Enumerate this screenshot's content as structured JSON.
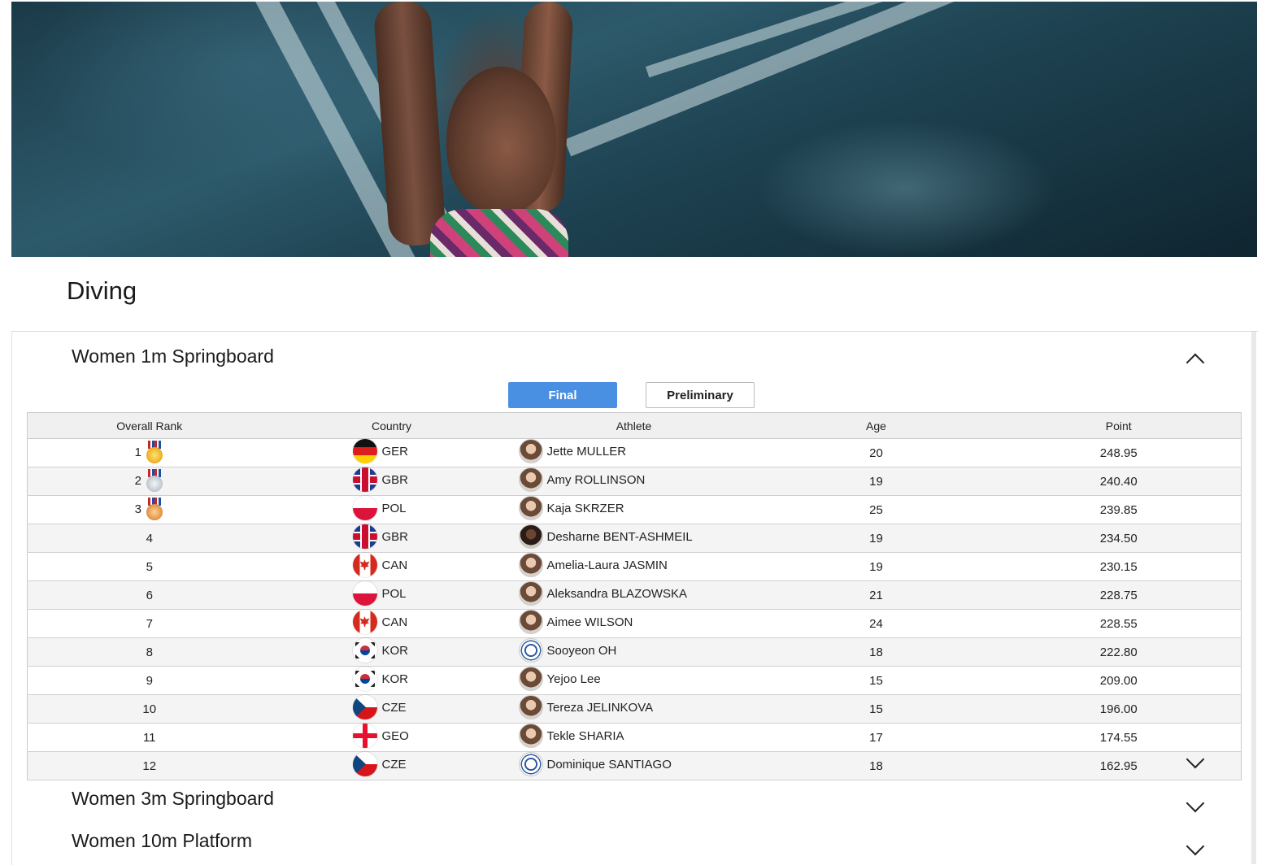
{
  "page": {
    "title": "Diving"
  },
  "sections": [
    {
      "title": "Women 1m Springboard",
      "expanded": true
    },
    {
      "title": "Women 3m Springboard",
      "expanded": false
    },
    {
      "title": "Women 10m Platform",
      "expanded": false
    }
  ],
  "tabs": {
    "final": "Final",
    "preliminary": "Preliminary",
    "active": "final"
  },
  "table": {
    "headers": {
      "rank": "Overall Rank",
      "country": "Country",
      "athlete": "Athlete",
      "age": "Age",
      "point": "Point"
    },
    "rows": [
      {
        "rank": "1",
        "medal": "gold",
        "country": "GER",
        "athlete": "Jette MULLER",
        "age": "20",
        "point": "248.95"
      },
      {
        "rank": "2",
        "medal": "silver",
        "country": "GBR",
        "athlete": "Amy ROLLINSON",
        "age": "19",
        "point": "240.40"
      },
      {
        "rank": "3",
        "medal": "bronze",
        "country": "POL",
        "athlete": "Kaja SKRZER",
        "age": "25",
        "point": "239.85"
      },
      {
        "rank": "4",
        "medal": "",
        "country": "GBR",
        "athlete": "Desharne BENT-ASHMEIL",
        "age": "19",
        "point": "234.50"
      },
      {
        "rank": "5",
        "medal": "",
        "country": "CAN",
        "athlete": "Amelia-Laura JASMIN",
        "age": "19",
        "point": "230.15"
      },
      {
        "rank": "6",
        "medal": "",
        "country": "POL",
        "athlete": "Aleksandra BLAZOWSKA",
        "age": "21",
        "point": "228.75"
      },
      {
        "rank": "7",
        "medal": "",
        "country": "CAN",
        "athlete": "Aimee WILSON",
        "age": "24",
        "point": "228.55"
      },
      {
        "rank": "8",
        "medal": "",
        "country": "KOR",
        "athlete": "Sooyeon OH",
        "age": "18",
        "point": "222.80"
      },
      {
        "rank": "9",
        "medal": "",
        "country": "KOR",
        "athlete": "Yejoo Lee",
        "age": "15",
        "point": "209.00"
      },
      {
        "rank": "10",
        "medal": "",
        "country": "CZE",
        "athlete": "Tereza JELINKOVA",
        "age": "15",
        "point": "196.00"
      },
      {
        "rank": "11",
        "medal": "",
        "country": "GEO",
        "athlete": "Tekle SHARIA",
        "age": "17",
        "point": "174.55"
      },
      {
        "rank": "12",
        "medal": "",
        "country": "CZE",
        "athlete": "Dominique SANTIAGO",
        "age": "18",
        "point": "162.95"
      }
    ]
  },
  "icons": {
    "collapse": "chevron-up-icon",
    "expand": "chevron-down-icon",
    "medals": [
      "gold-medal-icon",
      "silver-medal-icon",
      "bronze-medal-icon"
    ]
  },
  "colors": {
    "tab_active": "#4a90e2",
    "header_bg": "#f0f0f0",
    "alt_row_bg": "#f4f4f4"
  }
}
